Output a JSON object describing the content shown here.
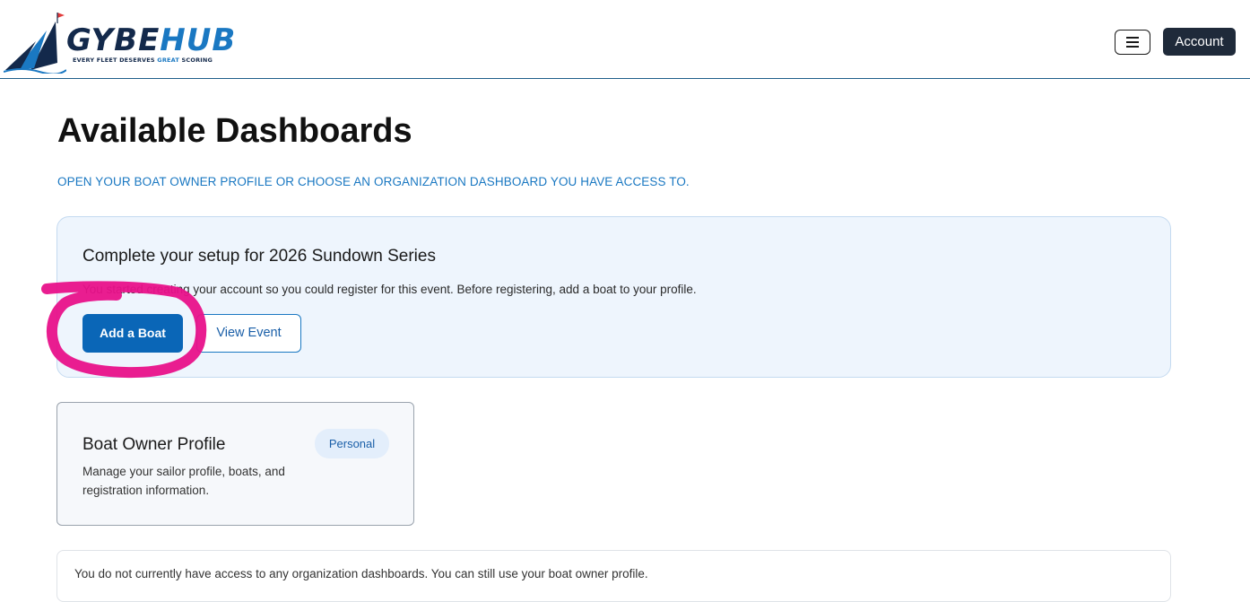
{
  "header": {
    "logo": {
      "word_part1": "GYBE",
      "word_part2": "HUB",
      "tagline_part1": "EVERY FLEET DESERVES ",
      "tagline_highlight": "GREAT",
      "tagline_part2": " SCORING"
    },
    "menu_icon": "hamburger-menu-icon",
    "account_label": "Account"
  },
  "main": {
    "title": "Available Dashboards",
    "subtitle": "OPEN YOUR BOAT OWNER PROFILE OR CHOOSE AN ORGANIZATION DASHBOARD YOU HAVE ACCESS TO.",
    "setup_card": {
      "title": "Complete your setup for 2026 Sundown Series",
      "text": "You started creating your account so you could register for this event. Before registering, add a boat to your profile.",
      "primary_button": "Add a Boat",
      "secondary_button": "View Event"
    },
    "profile_card": {
      "title": "Boat Owner Profile",
      "badge": "Personal",
      "description": "Manage your sailor profile, boats, and registration information."
    },
    "notice": "You do not currently have access to any organization dashboards. You can still use your boat owner profile."
  },
  "colors": {
    "brand_navy": "#13294b",
    "brand_blue": "#1a78c2",
    "primary_button": "#0a66b7",
    "account_button": "#1f2a3a",
    "annotation_magenta": "#e8118a"
  }
}
